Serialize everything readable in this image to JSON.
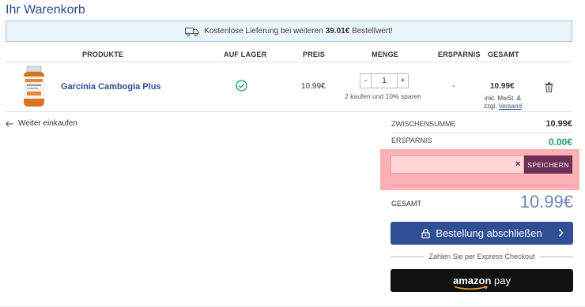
{
  "page": {
    "title": "Ihr Warenkorb"
  },
  "banner": {
    "icon": "truck-icon",
    "text_before": "Kostenlose Lieferung bei weiteren",
    "amount": "39.01€",
    "text_after": "Bestellwert!"
  },
  "table": {
    "columns": [
      "PRODUKTE",
      "AUF LAGER",
      "PREIS",
      "MENGE",
      "ERSPARNIS",
      "GESAMT"
    ],
    "item": {
      "name": "Garcinia Cambogia Plus",
      "in_stock_icon": "check-circle-icon",
      "price": "10.99€",
      "qty_minus": "-",
      "quantity": "1",
      "qty_plus": "+",
      "deal": "2 kaufen und 10% sparen",
      "saving": "-",
      "total": "10.99€",
      "tax_line1": "inkl. MwSt. &",
      "tax_line2": "zzgl.",
      "tax_link": "Versand",
      "delete_icon": "trash-icon"
    }
  },
  "continue_shopping": "Weiter einkaufen",
  "summary": {
    "subtotal_label": "ZWISCHENSUMME",
    "subtotal_value": "10.99€",
    "savings_label": "ERSPARNIS",
    "savings_value": "0.00€",
    "savings_color": "#1a9e6b",
    "coupon_clear": "×",
    "coupon_button": "SPEICHERN",
    "total_label": "GESAMT",
    "total_value": "10.99€",
    "checkout_button": "Bestellung abschließen",
    "express_label": "Zahlen Sie per Express Checkout",
    "amazon_brand": "amazon",
    "amazon_pay": "pay"
  },
  "colors": {
    "brand": "#2d4e8f",
    "checkout": "#2f4f95",
    "coupon_button": "#6e2e55",
    "highlight": "#fbb0b3"
  }
}
